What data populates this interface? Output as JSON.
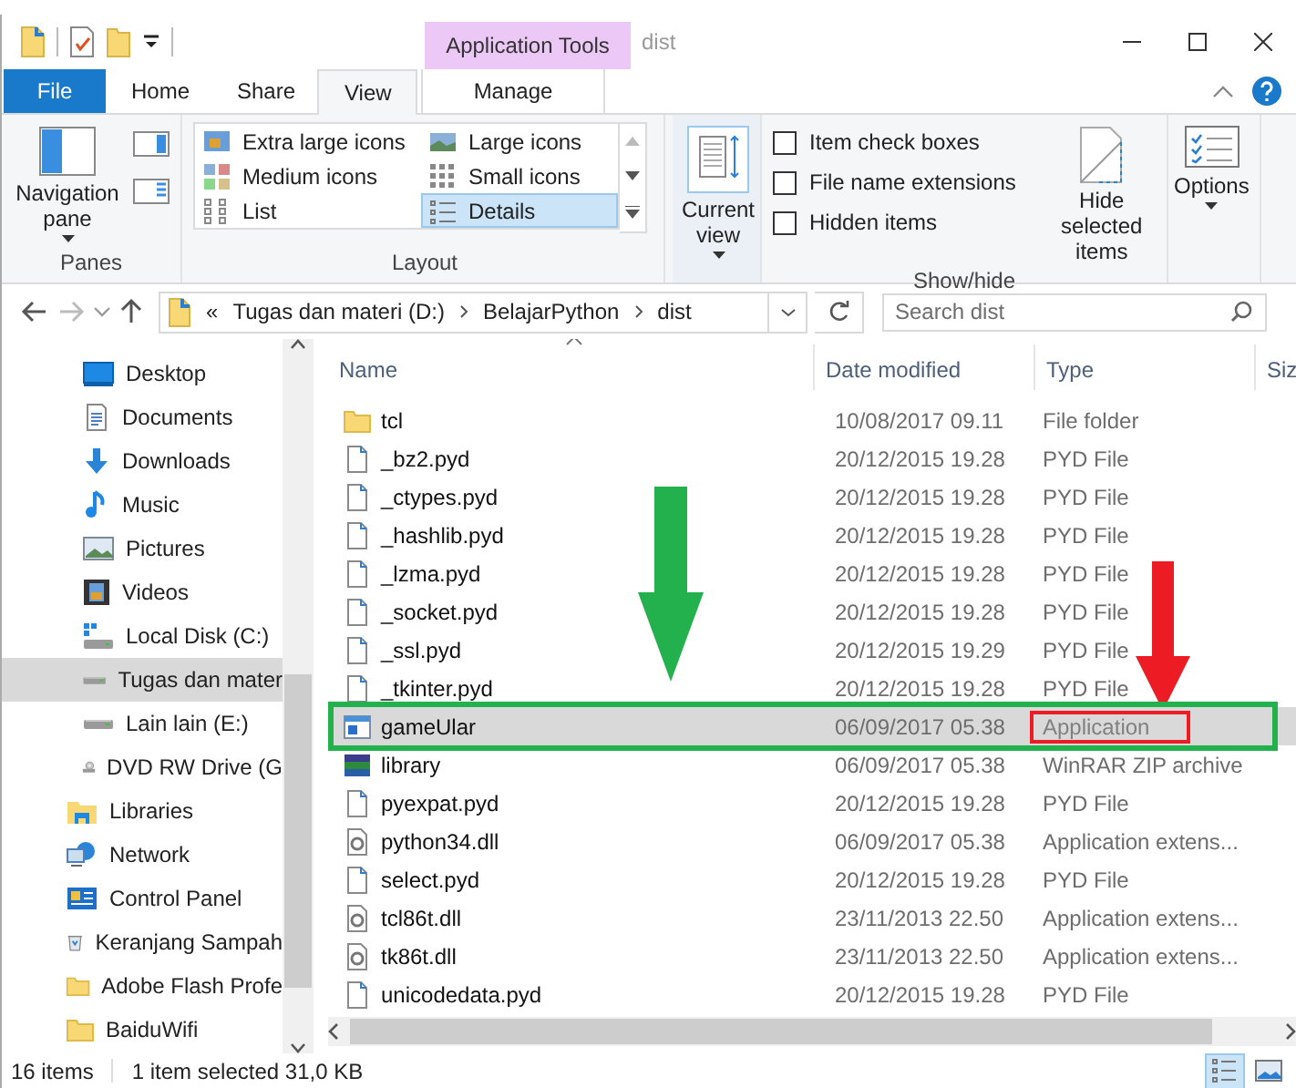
{
  "window": {
    "title": "dist"
  },
  "contextual_group": "Application Tools",
  "tabs": [
    {
      "label": "File",
      "kind": "file",
      "selected": false
    },
    {
      "label": "Home",
      "kind": "normal",
      "selected": false
    },
    {
      "label": "Share",
      "kind": "normal",
      "selected": false
    },
    {
      "label": "View",
      "kind": "normal",
      "selected": true
    },
    {
      "label": "Manage",
      "kind": "contextual",
      "selected": false
    }
  ],
  "ribbon": {
    "panes": {
      "label": "Panes",
      "navigation_pane": "Navigation pane"
    },
    "layout": {
      "label": "Layout",
      "options": [
        {
          "label": "Extra large icons",
          "kind": "xl",
          "selected": false
        },
        {
          "label": "Large icons",
          "kind": "large",
          "selected": false
        },
        {
          "label": "Medium icons",
          "kind": "medium",
          "selected": false
        },
        {
          "label": "Small icons",
          "kind": "small",
          "selected": false
        },
        {
          "label": "List",
          "kind": "list",
          "selected": false
        },
        {
          "label": "Details",
          "kind": "details",
          "selected": true
        }
      ]
    },
    "current_view": "Current view",
    "show_hide": {
      "label": "Show/hide",
      "checkboxes": [
        {
          "label": "Item check boxes",
          "checked": false
        },
        {
          "label": "File name extensions",
          "checked": false
        },
        {
          "label": "Hidden items",
          "checked": false
        }
      ],
      "hide_selected": "Hide selected items"
    },
    "options": "Options"
  },
  "address": {
    "overflow": "«",
    "crumbs": [
      "Tugas dan materi (D:)",
      "BelajarPython",
      "dist"
    ]
  },
  "search": {
    "placeholder": "Search dist"
  },
  "sidebar": {
    "pc_items": [
      {
        "label": "Desktop",
        "kind": "desktop",
        "selected": false
      },
      {
        "label": "Documents",
        "kind": "documents",
        "selected": false
      },
      {
        "label": "Downloads",
        "kind": "downloads",
        "selected": false
      },
      {
        "label": "Music",
        "kind": "music",
        "selected": false
      },
      {
        "label": "Pictures",
        "kind": "pictures",
        "selected": false
      },
      {
        "label": "Videos",
        "kind": "videos",
        "selected": false
      },
      {
        "label": "Local Disk (C:)",
        "kind": "sysdrive",
        "selected": false
      },
      {
        "label": "Tugas dan mater",
        "kind": "drive",
        "selected": true
      },
      {
        "label": "Lain lain (E:)",
        "kind": "drive",
        "selected": false
      },
      {
        "label": "DVD RW Drive (G",
        "kind": "dvd",
        "selected": false
      }
    ],
    "items": [
      {
        "label": "Libraries",
        "kind": "libraries",
        "selected": false
      },
      {
        "label": "Network",
        "kind": "network",
        "selected": false
      },
      {
        "label": "Control Panel",
        "kind": "control",
        "selected": false
      },
      {
        "label": "Keranjang Sampah",
        "kind": "recycle",
        "selected": false
      },
      {
        "label": "Adobe Flash Profe",
        "kind": "folder",
        "selected": false
      },
      {
        "label": "BaiduWifi",
        "kind": "folder",
        "selected": false
      }
    ]
  },
  "table": {
    "columns": [
      "Name",
      "Date modified",
      "Type",
      "Siz"
    ],
    "rows": [
      {
        "name": "tcl",
        "kind": "folder",
        "date": "10/08/2017 09.11",
        "type": "File folder",
        "selected": false,
        "highlighted": false,
        "type_marked": false
      },
      {
        "name": "_bz2.pyd",
        "kind": "file",
        "date": "20/12/2015 19.28",
        "type": "PYD File",
        "selected": false,
        "highlighted": false,
        "type_marked": false
      },
      {
        "name": "_ctypes.pyd",
        "kind": "file",
        "date": "20/12/2015 19.28",
        "type": "PYD File",
        "selected": false,
        "highlighted": false,
        "type_marked": false
      },
      {
        "name": "_hashlib.pyd",
        "kind": "file",
        "date": "20/12/2015 19.28",
        "type": "PYD File",
        "selected": false,
        "highlighted": false,
        "type_marked": false
      },
      {
        "name": "_lzma.pyd",
        "kind": "file",
        "date": "20/12/2015 19.28",
        "type": "PYD File",
        "selected": false,
        "highlighted": false,
        "type_marked": false
      },
      {
        "name": "_socket.pyd",
        "kind": "file",
        "date": "20/12/2015 19.28",
        "type": "PYD File",
        "selected": false,
        "highlighted": false,
        "type_marked": false
      },
      {
        "name": "_ssl.pyd",
        "kind": "file",
        "date": "20/12/2015 19.29",
        "type": "PYD File",
        "selected": false,
        "highlighted": false,
        "type_marked": false
      },
      {
        "name": "_tkinter.pyd",
        "kind": "file",
        "date": "20/12/2015 19.28",
        "type": "PYD File",
        "selected": false,
        "highlighted": false,
        "type_marked": false
      },
      {
        "name": "gameUlar",
        "kind": "app",
        "date": "06/09/2017 05.38",
        "type": "Application",
        "selected": true,
        "highlighted": true,
        "type_marked": true
      },
      {
        "name": "library",
        "kind": "archive",
        "date": "06/09/2017 05.38",
        "type": "WinRAR ZIP archive",
        "selected": false,
        "highlighted": false,
        "type_marked": false
      },
      {
        "name": "pyexpat.pyd",
        "kind": "file",
        "date": "20/12/2015 19.28",
        "type": "PYD File",
        "selected": false,
        "highlighted": false,
        "type_marked": false
      },
      {
        "name": "python34.dll",
        "kind": "dll",
        "date": "06/09/2017 05.38",
        "type": "Application extens...",
        "selected": false,
        "highlighted": false,
        "type_marked": false
      },
      {
        "name": "select.pyd",
        "kind": "file",
        "date": "20/12/2015 19.28",
        "type": "PYD File",
        "selected": false,
        "highlighted": false,
        "type_marked": false
      },
      {
        "name": "tcl86t.dll",
        "kind": "dll",
        "date": "23/11/2013 22.50",
        "type": "Application extens...",
        "selected": false,
        "highlighted": false,
        "type_marked": false
      },
      {
        "name": "tk86t.dll",
        "kind": "dll",
        "date": "23/11/2013 22.50",
        "type": "Application extens...",
        "selected": false,
        "highlighted": false,
        "type_marked": false
      },
      {
        "name": "unicodedata.pyd",
        "kind": "file",
        "date": "20/12/2015 19.28",
        "type": "PYD File",
        "selected": false,
        "highlighted": false,
        "type_marked": false
      }
    ]
  },
  "status_bar": {
    "count": "16 items",
    "selection": "1 item selected  31,0 KB",
    "views": [
      {
        "kind": "details",
        "selected": true
      },
      {
        "kind": "large",
        "selected": false
      }
    ]
  }
}
